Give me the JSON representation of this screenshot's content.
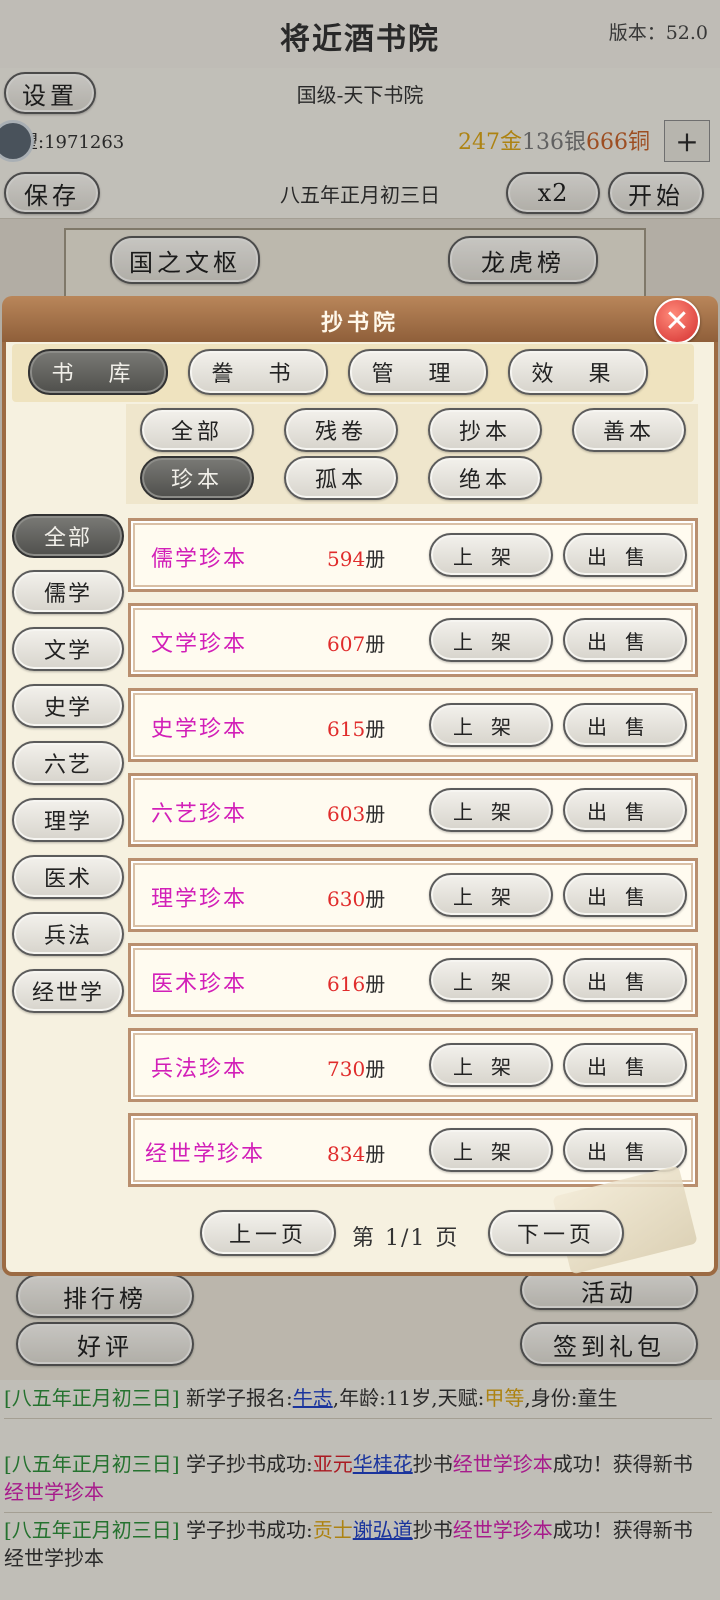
{
  "header": {
    "title": "将近酒书院",
    "version": "版本：52.0"
  },
  "settings_label": "设置",
  "rank_text": "国级-天下书院",
  "prestige": "望:1971263",
  "currency": {
    "gold": "247金",
    "silver": "136银",
    "copper": "666铜",
    "plus": "+"
  },
  "save_label": "保存",
  "date": "八五年正月初三日",
  "speed_label": "x2",
  "start_label": "开始",
  "scene_buttons": {
    "left": "国之文枢",
    "right": "龙虎榜"
  },
  "modal": {
    "title": "抄书院",
    "close": "✕",
    "tabs": [
      "书 库",
      "誊 书",
      "管 理",
      "效 果"
    ],
    "filters": [
      "全部",
      "残卷",
      "抄本",
      "善本",
      "珍本",
      "孤本",
      "绝本"
    ],
    "categories": [
      "全部",
      "儒学",
      "文学",
      "史学",
      "六艺",
      "理学",
      "医术",
      "兵法",
      "经世学"
    ],
    "books": [
      {
        "name": "儒学珍本",
        "count": "594",
        "unit": "册"
      },
      {
        "name": "文学珍本",
        "count": "607",
        "unit": "册"
      },
      {
        "name": "史学珍本",
        "count": "615",
        "unit": "册"
      },
      {
        "name": "六艺珍本",
        "count": "603",
        "unit": "册"
      },
      {
        "name": "理学珍本",
        "count": "630",
        "unit": "册"
      },
      {
        "name": "医术珍本",
        "count": "616",
        "unit": "册"
      },
      {
        "name": "兵法珍本",
        "count": "730",
        "unit": "册"
      },
      {
        "name": "经世学珍本",
        "count": "834",
        "unit": "册"
      }
    ],
    "shelve_label": "上架",
    "sell_label": "出售",
    "prev_label": "上一页",
    "next_label": "下一页",
    "page_info": "第 1/1 页"
  },
  "bottom_buttons": {
    "ranking": "排行榜",
    "activity": "活动",
    "review": "好评",
    "signin": "签到礼包"
  },
  "logs": [
    {
      "date": "[八五年正月初三日]",
      "p1": " 新学子报名:",
      "name": "牛志",
      "p2": ",年龄:11岁,天赋:",
      "talent": "甲等",
      "p3": ",身份:童生"
    },
    {
      "date": "[八五年正月初三日]",
      "p1": " 学子抄书成功:",
      "title": "亚元",
      "name": "华桂花",
      "p2": "抄书",
      "book": "经世学珍本",
      "p3": "成功！获得新书",
      "book2": "经世学珍本"
    },
    {
      "date": "[八五年正月初三日]",
      "p1": " 学子抄书成功:",
      "title": "贡士",
      "name": "谢弘道",
      "p2": "抄书",
      "book": "经世学珍本",
      "p3": "成功！获得新书经世学抄本"
    }
  ]
}
